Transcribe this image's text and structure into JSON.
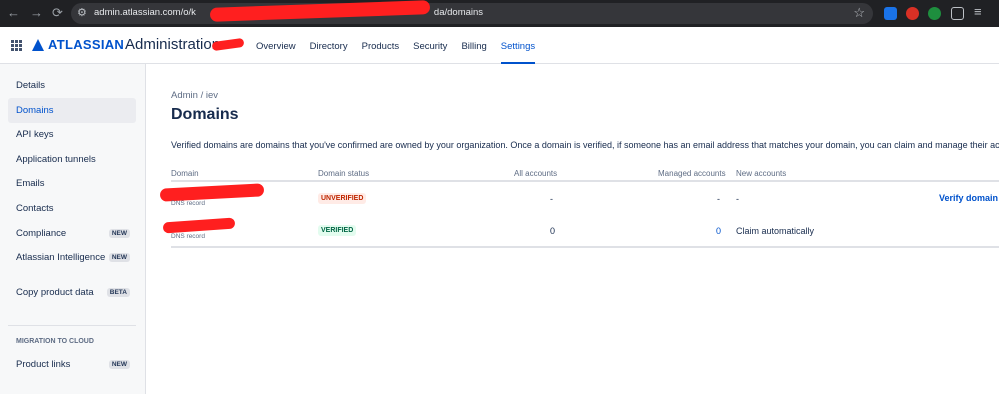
{
  "browser": {
    "url": "admin.atlassian.com/o/k",
    "url_tail": "da/domains",
    "nav": [
      "←",
      "→",
      "⟳"
    ]
  },
  "header": {
    "logo_text": "ATLASSIAN",
    "admin_label": "Administration",
    "tabs": [
      "Overview",
      "Directory",
      "Products",
      "Security",
      "Billing",
      "Settings"
    ],
    "active_tab": "Settings"
  },
  "sidebar": {
    "items": [
      {
        "label": "Details",
        "badge": ""
      },
      {
        "label": "Domains",
        "badge": ""
      },
      {
        "label": "API keys",
        "badge": ""
      },
      {
        "label": "Application tunnels",
        "badge": ""
      },
      {
        "label": "Emails",
        "badge": ""
      },
      {
        "label": "Contacts",
        "badge": ""
      },
      {
        "label": "Compliance",
        "badge": "NEW"
      },
      {
        "label": "Atlassian Intelligence",
        "badge": "NEW"
      },
      {
        "label": "Copy product data",
        "badge": "BETA"
      }
    ],
    "section_heading": "MIGRATION TO CLOUD",
    "section_items": [
      {
        "label": "Product links",
        "badge": "NEW"
      }
    ]
  },
  "main": {
    "breadcrumb": "Admin  /  iev",
    "title": "Domains",
    "description": "Verified domains are domains that you've confirmed are owned by your organization. Once a domain is verified, if someone has an email address that matches your domain, you can claim and manage their account. Lea",
    "columns": [
      "Domain",
      "Domain status",
      "All accounts",
      "Managed accounts",
      "New accounts"
    ],
    "rows": [
      {
        "sub": "DNS record",
        "status": "UNVERIFIED",
        "all": "-",
        "managed": "-",
        "new": "-",
        "action": "Verify domain"
      },
      {
        "sub": "DNS record",
        "status": "VERIFIED",
        "all": "0",
        "managed": "0",
        "new": "Claim automatically",
        "action": ""
      }
    ]
  },
  "colors": {
    "brand": "#0052cc",
    "redaction": "#ff1f1f"
  }
}
